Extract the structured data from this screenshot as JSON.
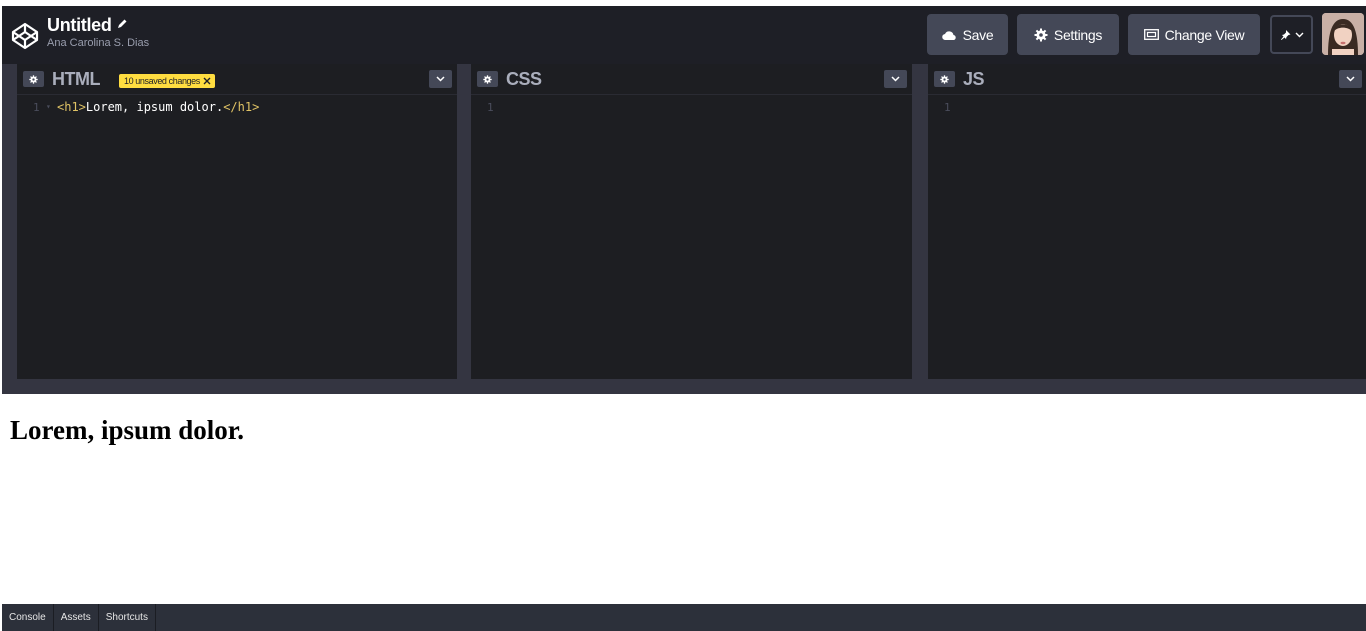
{
  "header": {
    "title": "Untitled",
    "owner": "Ana Carolina S. Dias",
    "save_label": "Save",
    "settings_label": "Settings",
    "change_view_label": "Change View"
  },
  "editors": {
    "html": {
      "title": "HTML",
      "unsaved_badge": "10 unsaved changes",
      "lines": [
        {
          "number": "1",
          "open_tag": "<h1>",
          "text": "Lorem, ipsum dolor.",
          "close_tag": "</h1>"
        }
      ]
    },
    "css": {
      "title": "CSS",
      "lines": [
        {
          "number": "1"
        }
      ]
    },
    "js": {
      "title": "JS",
      "lines": [
        {
          "number": "1"
        }
      ]
    }
  },
  "preview": {
    "heading": "Lorem, ipsum dolor."
  },
  "footer": {
    "console_label": "Console",
    "assets_label": "Assets",
    "shortcuts_label": "Shortcuts"
  },
  "colors": {
    "header_bg": "#1e1f26",
    "button_bg": "#444857",
    "editor_bg": "#1d1e22",
    "badge": "#ffdd40",
    "tag": "#e0c365"
  },
  "icons": {
    "logo": "codepen-logo-icon",
    "edit": "pencil-icon",
    "save": "cloud-icon",
    "settings": "gear-icon",
    "change_view": "layout-icon",
    "pin": "pin-icon",
    "collapse": "chevron-down-icon"
  }
}
